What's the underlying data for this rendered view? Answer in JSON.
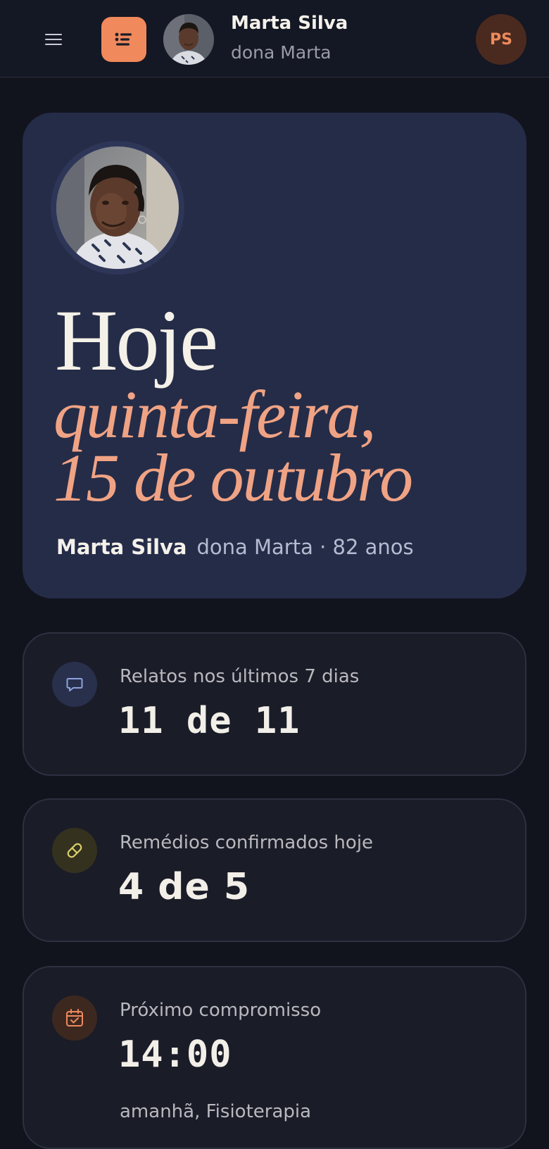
{
  "header": {
    "menu_icon": "hamburger-menu-icon",
    "list_icon": "list-icon",
    "patient_name": "Marta Silva",
    "patient_nickname": "dona Marta",
    "user_initials": "PS",
    "colors": {
      "accent": "#f0895c",
      "avatar_bg": "#4a2a1f"
    }
  },
  "hero": {
    "title": "Hoje",
    "date_line1": "quinta-feira,",
    "date_line2": "15 de outubro",
    "name": "Marta Silva",
    "details": "dona Marta · 82 anos",
    "colors": {
      "background": "#252c48",
      "date": "#f0a384"
    }
  },
  "cards": [
    {
      "icon": "chat-bubble-icon",
      "label": "Relatos nos últimos 7 dias",
      "value": "11 de 11"
    },
    {
      "icon": "pill-icon",
      "label": "Remédios confirmados hoje",
      "value": "4 de 5"
    },
    {
      "icon": "calendar-check-icon",
      "label": "Próximo compromisso",
      "value": "14:00",
      "sub": "amanhã, Fisioterapia"
    }
  ]
}
